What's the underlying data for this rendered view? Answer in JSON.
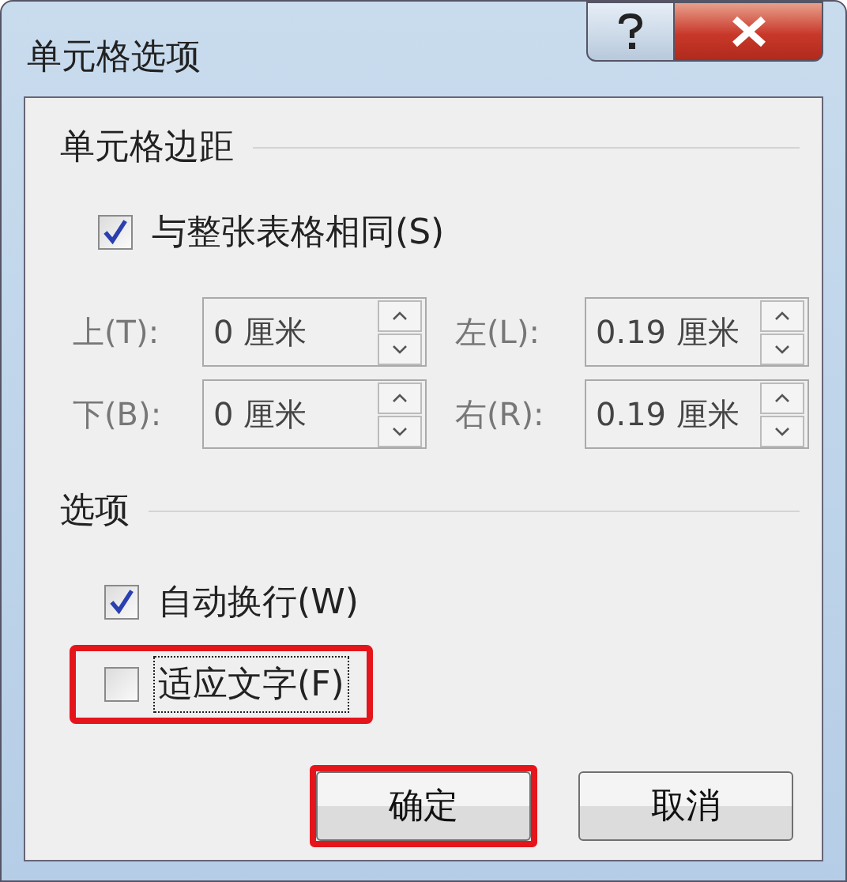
{
  "window": {
    "title": "单元格选项"
  },
  "margins": {
    "heading": "单元格边距",
    "same_as_table": {
      "label": "与整张表格相同(S)",
      "checked": true
    },
    "fields": [
      {
        "label": "上(T):",
        "value": "0 厘米",
        "disabled": true
      },
      {
        "label": "左(L):",
        "value": "0.19 厘米",
        "disabled": true
      },
      {
        "label": "下(B):",
        "value": "0 厘米",
        "disabled": true
      },
      {
        "label": "右(R):",
        "value": "0.19 厘米",
        "disabled": true
      }
    ]
  },
  "options": {
    "heading": "选项",
    "items": [
      {
        "label": "自动换行(W)",
        "checked": true,
        "focused": false,
        "highlighted": false
      },
      {
        "label": "适应文字(F)",
        "checked": false,
        "focused": true,
        "highlighted": true
      }
    ]
  },
  "buttons": [
    {
      "label": "确定",
      "highlighted": true
    },
    {
      "label": "取消",
      "highlighted": false
    }
  ]
}
